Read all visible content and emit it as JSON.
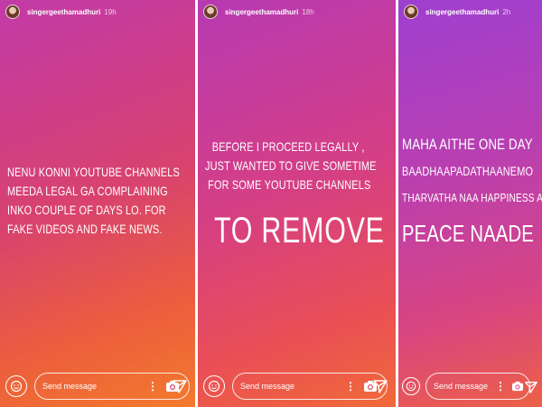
{
  "stories": [
    {
      "username": "singergeethamadhuri",
      "time": "19h",
      "text_lines": [
        "Nenu konni youtube channels",
        "meeda legal ga complaining",
        "inko couple of days lo. For",
        "fake videos and fake news."
      ],
      "footer": {
        "placeholder": "Send message"
      }
    },
    {
      "username": "singergeethamadhuri",
      "time": "18h",
      "text_lines": [
        "Before I proceed legally ,",
        "just wanted to give sometime",
        "for some youtube channels"
      ],
      "big_text": "TO REMOVE",
      "footer": {
        "placeholder": "Send message"
      }
    },
    {
      "username": "singergeethamadhuri",
      "time": "2h",
      "text_lines": [
        "Maha aithe one day",
        "Baadhaapadathaanemo",
        "Tharvatha naa happiness and"
      ],
      "big_text": "Peace naade",
      "footer": {
        "placeholder": "Send message"
      }
    }
  ],
  "icons": {
    "avatar": "profile-photo",
    "left": "camera-circle-icon",
    "more": "more-options-icon",
    "camera": "camera-icon",
    "send": "send-direct-icon"
  },
  "colors": {
    "text": "#ffffff"
  }
}
